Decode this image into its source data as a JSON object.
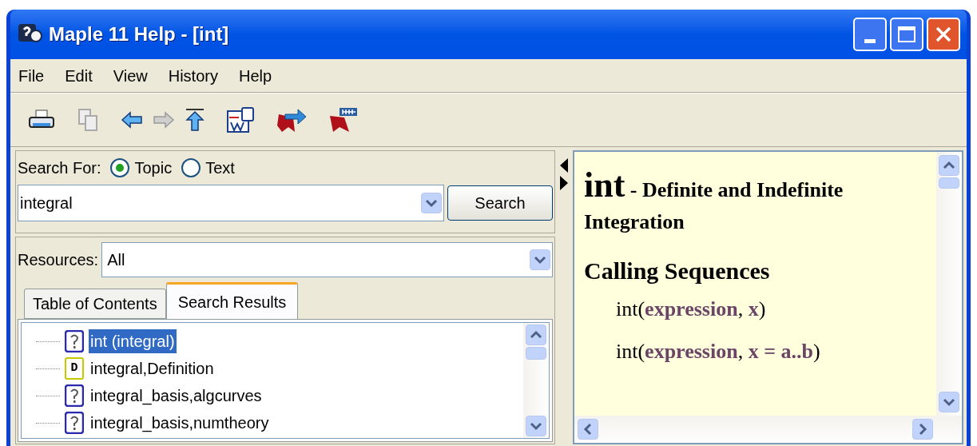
{
  "window": {
    "title": "Maple 11 Help - [int]"
  },
  "menu": [
    "File",
    "Edit",
    "View",
    "History",
    "Help"
  ],
  "search": {
    "label": "Search For:",
    "options": [
      {
        "label": "Topic",
        "selected": true
      },
      {
        "label": "Text",
        "selected": false
      }
    ],
    "value": "integral",
    "button": "Search"
  },
  "resources": {
    "label": "Resources:",
    "value": "All"
  },
  "tabs": [
    {
      "label": "Table of Contents",
      "selected": false
    },
    {
      "label": "Search Results",
      "selected": true
    }
  ],
  "results": [
    {
      "kind": "help",
      "label": "int (integral)",
      "selected": true
    },
    {
      "kind": "definition",
      "badge": "D",
      "label": "integral,Definition",
      "selected": false
    },
    {
      "kind": "help",
      "label": "integral_basis,algcurves",
      "selected": false
    },
    {
      "kind": "help",
      "label": "integral_basis,numtheory",
      "selected": false
    }
  ],
  "document": {
    "topic": "int",
    "title": "- Definite and Indefinite Integration",
    "section": "Calling Sequences",
    "sequences": [
      "int(**expression**, **x**)",
      "int(**expression**, **x = a..b**)"
    ]
  }
}
